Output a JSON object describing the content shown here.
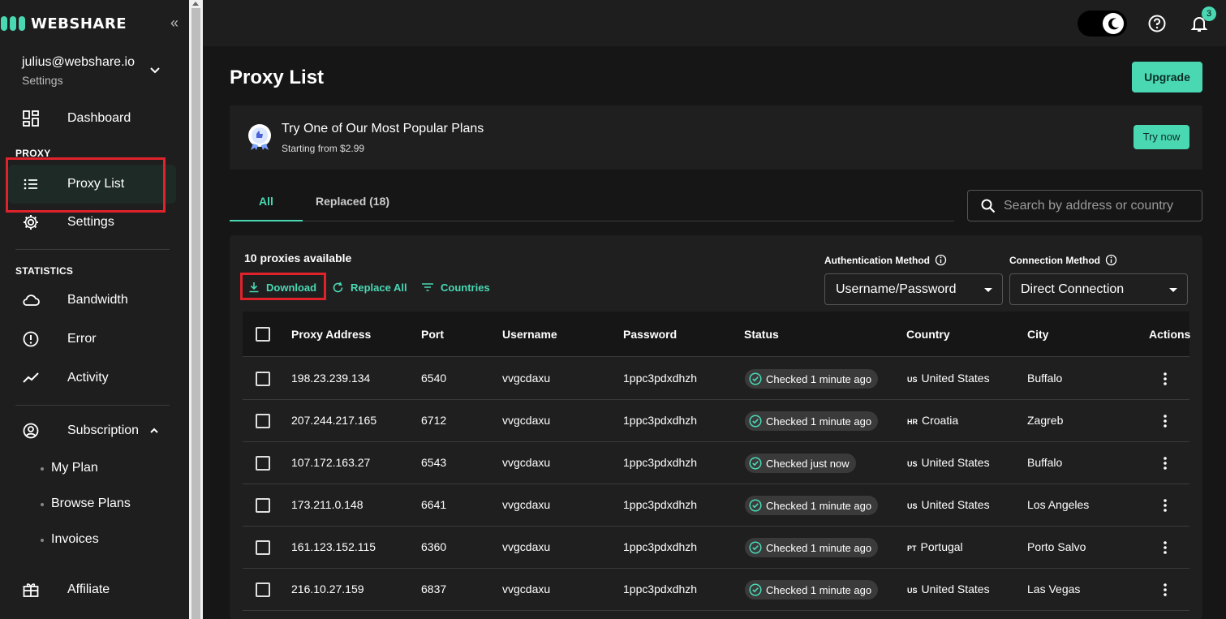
{
  "brand": {
    "name": "WEBSHARE",
    "accent": "#4ad8b3"
  },
  "account": {
    "email": "julius@webshare.io",
    "subtitle": "Settings"
  },
  "sidebar": {
    "dashboard": "Dashboard",
    "proxy_section": "PROXY",
    "proxy_list": "Proxy List",
    "settings": "Settings",
    "statistics_section": "STATISTICS",
    "bandwidth": "Bandwidth",
    "error": "Error",
    "activity": "Activity",
    "subscription": "Subscription",
    "my_plan": "My Plan",
    "browse_plans": "Browse Plans",
    "invoices": "Invoices",
    "affiliate": "Affiliate"
  },
  "topbar": {
    "notification_count": "3"
  },
  "page": {
    "title": "Proxy List",
    "upgrade_label": "Upgrade"
  },
  "promo": {
    "title": "Try One of Our Most Popular Plans",
    "subtitle": "Starting from $2.99",
    "cta": "Try now"
  },
  "tabs": {
    "all": "All",
    "replaced": "Replaced (18)"
  },
  "search": {
    "placeholder": "Search by address or country"
  },
  "list": {
    "count_text": "10 proxies available",
    "download": "Download",
    "replace_all": "Replace All",
    "countries": "Countries",
    "auth_label": "Authentication Method",
    "auth_value": "Username/Password",
    "conn_label": "Connection Method",
    "conn_value": "Direct Connection"
  },
  "table": {
    "headers": [
      "Proxy Address",
      "Port",
      "Username",
      "Password",
      "Status",
      "Country",
      "City",
      "Actions"
    ],
    "rows": [
      {
        "address": "198.23.239.134",
        "port": "6540",
        "username": "vvgcdaxu",
        "password": "1ppc3pdxdhzh",
        "status": "Checked 1 minute ago",
        "cc": "US",
        "country": "United States",
        "city": "Buffalo"
      },
      {
        "address": "207.244.217.165",
        "port": "6712",
        "username": "vvgcdaxu",
        "password": "1ppc3pdxdhzh",
        "status": "Checked 1 minute ago",
        "cc": "HR",
        "country": "Croatia",
        "city": "Zagreb"
      },
      {
        "address": "107.172.163.27",
        "port": "6543",
        "username": "vvgcdaxu",
        "password": "1ppc3pdxdhzh",
        "status": "Checked just now",
        "cc": "US",
        "country": "United States",
        "city": "Buffalo"
      },
      {
        "address": "173.211.0.148",
        "port": "6641",
        "username": "vvgcdaxu",
        "password": "1ppc3pdxdhzh",
        "status": "Checked 1 minute ago",
        "cc": "US",
        "country": "United States",
        "city": "Los Angeles"
      },
      {
        "address": "161.123.152.115",
        "port": "6360",
        "username": "vvgcdaxu",
        "password": "1ppc3pdxdhzh",
        "status": "Checked 1 minute ago",
        "cc": "PT",
        "country": "Portugal",
        "city": "Porto Salvo"
      },
      {
        "address": "216.10.27.159",
        "port": "6837",
        "username": "vvgcdaxu",
        "password": "1ppc3pdxdhzh",
        "status": "Checked 1 minute ago",
        "cc": "US",
        "country": "United States",
        "city": "Las Vegas"
      }
    ]
  }
}
